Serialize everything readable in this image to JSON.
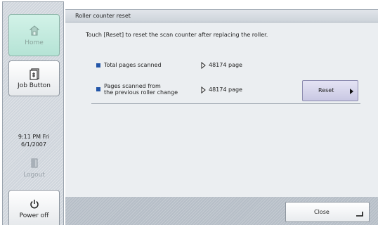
{
  "sidebar": {
    "home_label": "Home",
    "job_label": "Job Button",
    "clock_time": "9:11 PM  Fri",
    "clock_date": "6/1/2007",
    "logout_label": "Logout",
    "power_label": "Power off"
  },
  "header": {
    "title": "Roller counter reset"
  },
  "main": {
    "instruction": "Touch [Reset] to reset the scan counter after replacing the roller.",
    "rows": [
      {
        "label_line1": "Total pages scanned",
        "label_line2": "",
        "value": "48174 page"
      },
      {
        "label_line1": "Pages scanned from",
        "label_line2": "the previous roller change",
        "value": "48174 page"
      }
    ],
    "reset_label": "Reset"
  },
  "footer": {
    "close_label": "Close"
  },
  "colors": {
    "bullet": "#2255a8",
    "home_button": "#c4ebdf",
    "reset_button": "#d6d5ec",
    "sidebar_bg": "#cfd5dc"
  },
  "icons": {
    "home": "home-icon",
    "job": "job-button-icon",
    "logout": "logout-door-icon",
    "power": "power-icon",
    "value_marker": "triangle-right-outline-icon",
    "reset_arrow": "triangle-right-filled-icon",
    "close_enter": "enter-return-icon"
  }
}
